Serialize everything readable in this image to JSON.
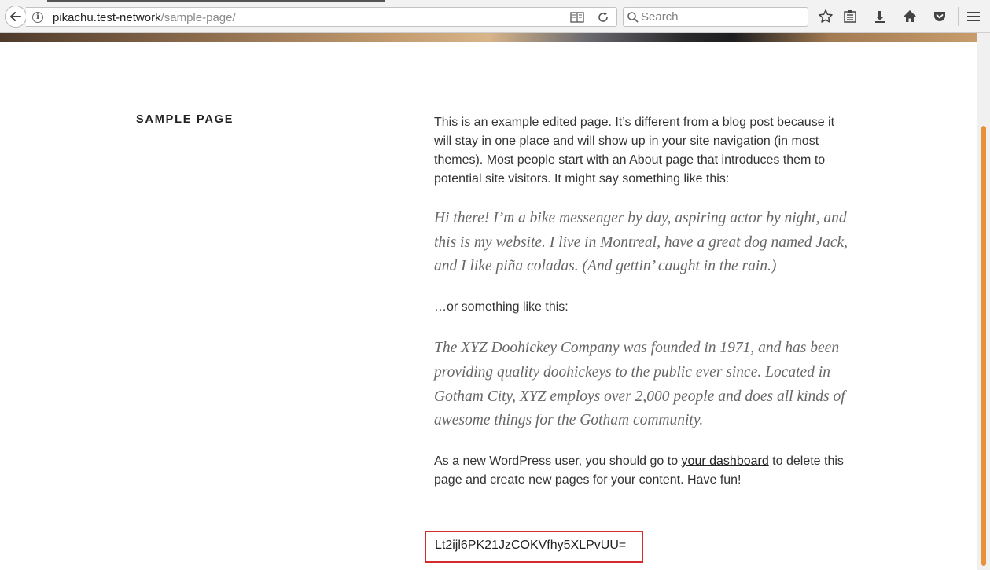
{
  "browser": {
    "url_host": "pikachu.test-network",
    "url_path": "/sample-page/",
    "search_placeholder": "Search"
  },
  "page": {
    "title": "Sample Page",
    "intro": "This is an example edited  page. It’s different from a blog post because it will stay in one place and will show up in your site navigation (in most themes). Most people start with an About page that introduces them to potential site visitors. It might say something like this:",
    "quote1": "Hi there! I’m a bike messenger by day, aspiring actor by night, and this is my website. I live in Montreal, have a great dog named Jack, and I like piña coladas. (And gettin’ caught in the rain.)",
    "or_text": "…or something like this:",
    "quote2": "The XYZ Doohickey Company was founded in 1971, and has been providing quality doohickeys to the public ever since. Located in Gotham City, XYZ employs over 2,000 people and does all kinds of awesome things for the Gotham community.",
    "closing_before": "As a new WordPress user, you should go to ",
    "dashboard_link": "your dashboard",
    "closing_after": " to delete this page and create new pages for your content. Have fun!",
    "code": "Lt2ijl6PK21JzCOKVfhy5XLPvUU="
  }
}
